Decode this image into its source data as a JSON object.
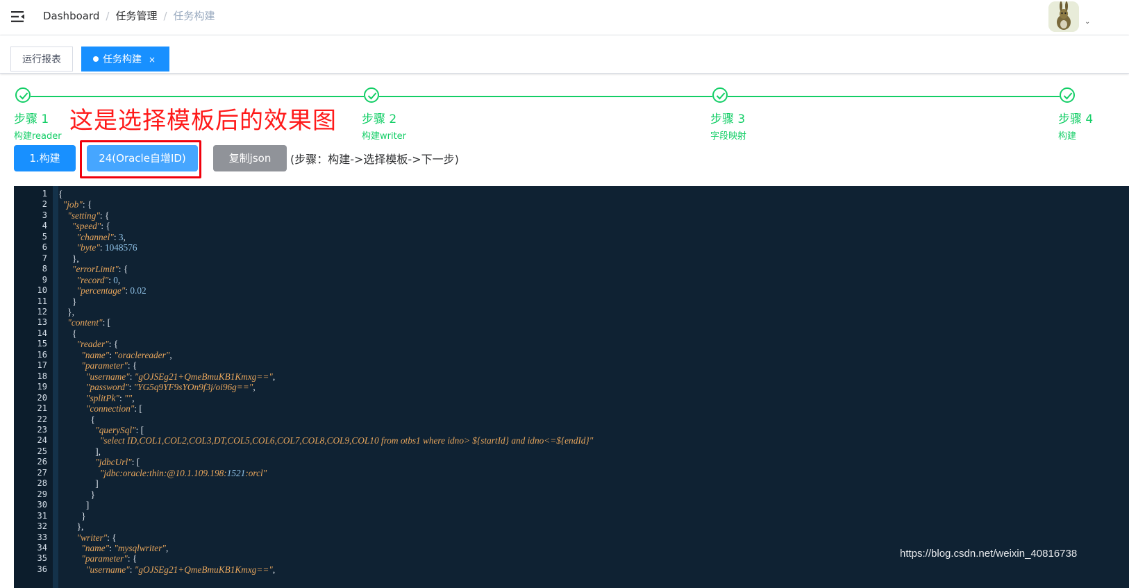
{
  "navbar": {
    "menu_icon": "hamburger-fold-icon",
    "breadcrumb": [
      "Dashboard",
      "任务管理",
      "任务构建"
    ],
    "separator": "/",
    "avatar_icon": "user-avatar-rabbit",
    "avatar_caret": "⌄"
  },
  "tags": [
    {
      "label": "运行报表",
      "active": false
    },
    {
      "label": "任务构建",
      "active": true,
      "close": "×"
    }
  ],
  "steps": [
    {
      "title": "步骤 1",
      "description": "构建reader",
      "status": "finish"
    },
    {
      "title": "步骤 2",
      "description": "构建writer",
      "status": "finish"
    },
    {
      "title": "步骤 3",
      "description": "字段映射",
      "status": "finish"
    },
    {
      "title": "步骤 4",
      "description": "构建",
      "status": "finish"
    }
  ],
  "annotation": "这是选择模板后的效果图",
  "buttons": {
    "build": "1.构建",
    "template": "24(Oracle自增ID)",
    "copy_json": "复制json"
  },
  "hint": "(步骤：构建->选择模板->下一步)",
  "colors": {
    "primary": "#1890ff",
    "success": "#13ce66",
    "annotation": "#ff1a1a",
    "editor_bg": "#0f2233"
  },
  "code_lines": [
    "{",
    "  \"job\": {",
    "    \"setting\": {",
    "      \"speed\": {",
    "        \"channel\": 3,",
    "        \"byte\": 1048576",
    "      },",
    "      \"errorLimit\": {",
    "        \"record\": 0,",
    "        \"percentage\": 0.02",
    "      }",
    "    },",
    "    \"content\": [",
    "      {",
    "        \"reader\": {",
    "          \"name\": \"oraclereader\",",
    "          \"parameter\": {",
    "            \"username\": \"gOJSEg21+QmeBmuKB1Kmxg==\",",
    "            \"password\": \"YG5q9YF9sYOn9f3j/oi96g==\",",
    "            \"splitPk\": \"\",",
    "            \"connection\": [",
    "              {",
    "                \"querySql\": [",
    "                  \"select ID,COL1,COL2,COL3,DT,COL5,COL6,COL7,COL8,COL9,COL10 from otbs1 where idno> ${startId} and idno<=${endId}\"",
    "                ],",
    "                \"jdbcUrl\": [",
    "                  \"jdbc:oracle:thin:@10.1.109.198:1521:orcl\"",
    "                ]",
    "              }",
    "            ]",
    "          }",
    "        },",
    "        \"writer\": {",
    "          \"name\": \"mysqlwriter\",",
    "          \"parameter\": {",
    "            \"username\": \"gOJSEg21+QmeBmuKB1Kmxg==\","
  ],
  "watermark": "https://blog.csdn.net/weixin_40816738"
}
